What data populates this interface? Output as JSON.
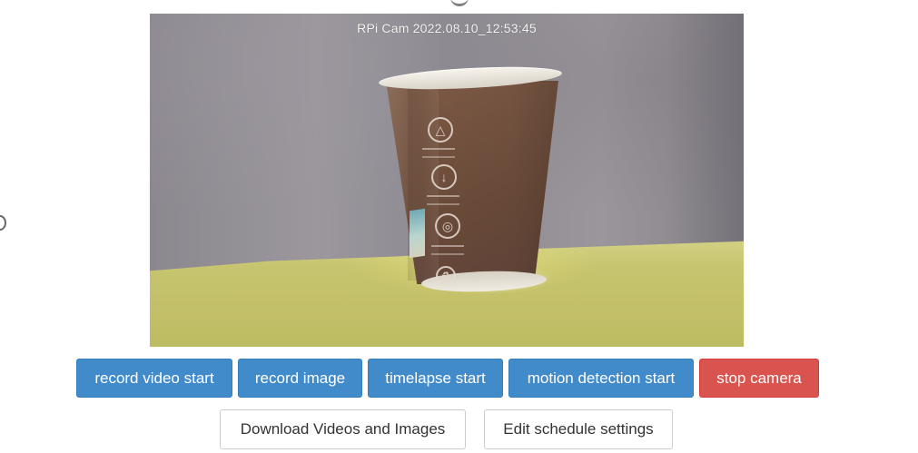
{
  "camera": {
    "overlay_text": "RPi Cam 2022.08.10_12:53:45"
  },
  "actions": {
    "record_video": "record video start",
    "record_image": "record image",
    "timelapse": "timelapse start",
    "motion_detection": "motion detection start",
    "stop_camera": "stop camera",
    "download": "Download Videos and Images",
    "schedule": "Edit schedule settings"
  },
  "colors": {
    "primary_button": "#428bca",
    "danger_button": "#d9534f",
    "default_button_border": "#cccccc"
  },
  "icons": {
    "cup_symbols": [
      "recycle-icon",
      "compost-icon",
      "info-icon",
      "sustainability-icon"
    ]
  }
}
